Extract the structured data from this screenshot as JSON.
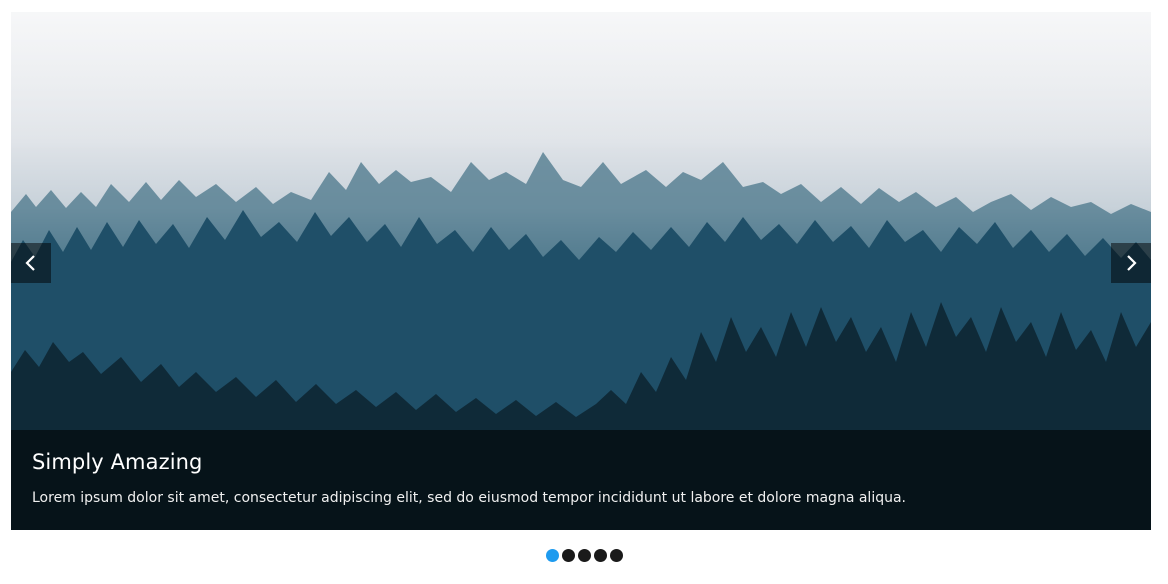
{
  "slider": {
    "caption": {
      "title": "Simply Amazing",
      "text": "Lorem ipsum dolor sit amet, consectetur adipiscing elit, sed do eiusmod tempor incididunt ut labore et dolore magna aliqua."
    },
    "controls": {
      "prev_icon": "chevron-left-icon",
      "next_icon": "chevron-right-icon"
    },
    "pager": {
      "count": 5,
      "active_index": 0,
      "active_color": "#1e9bef",
      "inactive_color": "#1a1a1a"
    }
  }
}
